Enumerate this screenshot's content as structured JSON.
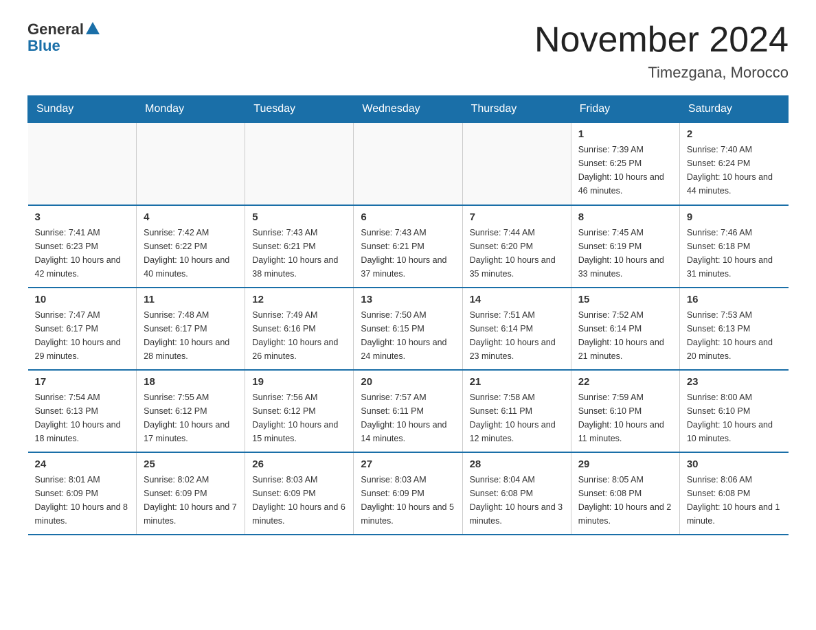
{
  "logo": {
    "general_text": "General",
    "blue_text": "Blue"
  },
  "header": {
    "month_title": "November 2024",
    "location": "Timezgana, Morocco"
  },
  "days_of_week": [
    "Sunday",
    "Monday",
    "Tuesday",
    "Wednesday",
    "Thursday",
    "Friday",
    "Saturday"
  ],
  "weeks": [
    [
      {
        "day": "",
        "info": ""
      },
      {
        "day": "",
        "info": ""
      },
      {
        "day": "",
        "info": ""
      },
      {
        "day": "",
        "info": ""
      },
      {
        "day": "",
        "info": ""
      },
      {
        "day": "1",
        "info": "Sunrise: 7:39 AM\nSunset: 6:25 PM\nDaylight: 10 hours and 46 minutes."
      },
      {
        "day": "2",
        "info": "Sunrise: 7:40 AM\nSunset: 6:24 PM\nDaylight: 10 hours and 44 minutes."
      }
    ],
    [
      {
        "day": "3",
        "info": "Sunrise: 7:41 AM\nSunset: 6:23 PM\nDaylight: 10 hours and 42 minutes."
      },
      {
        "day": "4",
        "info": "Sunrise: 7:42 AM\nSunset: 6:22 PM\nDaylight: 10 hours and 40 minutes."
      },
      {
        "day": "5",
        "info": "Sunrise: 7:43 AM\nSunset: 6:21 PM\nDaylight: 10 hours and 38 minutes."
      },
      {
        "day": "6",
        "info": "Sunrise: 7:43 AM\nSunset: 6:21 PM\nDaylight: 10 hours and 37 minutes."
      },
      {
        "day": "7",
        "info": "Sunrise: 7:44 AM\nSunset: 6:20 PM\nDaylight: 10 hours and 35 minutes."
      },
      {
        "day": "8",
        "info": "Sunrise: 7:45 AM\nSunset: 6:19 PM\nDaylight: 10 hours and 33 minutes."
      },
      {
        "day": "9",
        "info": "Sunrise: 7:46 AM\nSunset: 6:18 PM\nDaylight: 10 hours and 31 minutes."
      }
    ],
    [
      {
        "day": "10",
        "info": "Sunrise: 7:47 AM\nSunset: 6:17 PM\nDaylight: 10 hours and 29 minutes."
      },
      {
        "day": "11",
        "info": "Sunrise: 7:48 AM\nSunset: 6:17 PM\nDaylight: 10 hours and 28 minutes."
      },
      {
        "day": "12",
        "info": "Sunrise: 7:49 AM\nSunset: 6:16 PM\nDaylight: 10 hours and 26 minutes."
      },
      {
        "day": "13",
        "info": "Sunrise: 7:50 AM\nSunset: 6:15 PM\nDaylight: 10 hours and 24 minutes."
      },
      {
        "day": "14",
        "info": "Sunrise: 7:51 AM\nSunset: 6:14 PM\nDaylight: 10 hours and 23 minutes."
      },
      {
        "day": "15",
        "info": "Sunrise: 7:52 AM\nSunset: 6:14 PM\nDaylight: 10 hours and 21 minutes."
      },
      {
        "day": "16",
        "info": "Sunrise: 7:53 AM\nSunset: 6:13 PM\nDaylight: 10 hours and 20 minutes."
      }
    ],
    [
      {
        "day": "17",
        "info": "Sunrise: 7:54 AM\nSunset: 6:13 PM\nDaylight: 10 hours and 18 minutes."
      },
      {
        "day": "18",
        "info": "Sunrise: 7:55 AM\nSunset: 6:12 PM\nDaylight: 10 hours and 17 minutes."
      },
      {
        "day": "19",
        "info": "Sunrise: 7:56 AM\nSunset: 6:12 PM\nDaylight: 10 hours and 15 minutes."
      },
      {
        "day": "20",
        "info": "Sunrise: 7:57 AM\nSunset: 6:11 PM\nDaylight: 10 hours and 14 minutes."
      },
      {
        "day": "21",
        "info": "Sunrise: 7:58 AM\nSunset: 6:11 PM\nDaylight: 10 hours and 12 minutes."
      },
      {
        "day": "22",
        "info": "Sunrise: 7:59 AM\nSunset: 6:10 PM\nDaylight: 10 hours and 11 minutes."
      },
      {
        "day": "23",
        "info": "Sunrise: 8:00 AM\nSunset: 6:10 PM\nDaylight: 10 hours and 10 minutes."
      }
    ],
    [
      {
        "day": "24",
        "info": "Sunrise: 8:01 AM\nSunset: 6:09 PM\nDaylight: 10 hours and 8 minutes."
      },
      {
        "day": "25",
        "info": "Sunrise: 8:02 AM\nSunset: 6:09 PM\nDaylight: 10 hours and 7 minutes."
      },
      {
        "day": "26",
        "info": "Sunrise: 8:03 AM\nSunset: 6:09 PM\nDaylight: 10 hours and 6 minutes."
      },
      {
        "day": "27",
        "info": "Sunrise: 8:03 AM\nSunset: 6:09 PM\nDaylight: 10 hours and 5 minutes."
      },
      {
        "day": "28",
        "info": "Sunrise: 8:04 AM\nSunset: 6:08 PM\nDaylight: 10 hours and 3 minutes."
      },
      {
        "day": "29",
        "info": "Sunrise: 8:05 AM\nSunset: 6:08 PM\nDaylight: 10 hours and 2 minutes."
      },
      {
        "day": "30",
        "info": "Sunrise: 8:06 AM\nSunset: 6:08 PM\nDaylight: 10 hours and 1 minute."
      }
    ]
  ]
}
